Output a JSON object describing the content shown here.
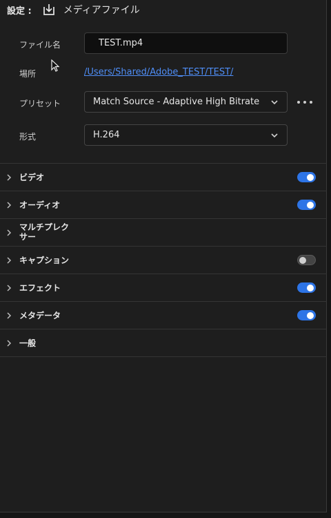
{
  "header": {
    "settings_label": "設定 :",
    "media_label": "メディアファイル",
    "export_icon": "download-icon"
  },
  "form": {
    "filename_label": "ファイル名",
    "filename_value": "TEST.mp4",
    "location_label": "場所",
    "location_value": "/Users/Shared/Adobe_TEST/TEST/",
    "preset_label": "プリセット",
    "preset_value": "Match Source - Adaptive High Bitrate",
    "format_label": "形式",
    "format_value": "H.264"
  },
  "sections": [
    {
      "title": "ビデオ",
      "toggle": "on"
    },
    {
      "title": "オーディオ",
      "toggle": "on"
    },
    {
      "title": "マルチプレクサー",
      "toggle": "none"
    },
    {
      "title": "キャプション",
      "toggle": "off"
    },
    {
      "title": "エフェクト",
      "toggle": "on"
    },
    {
      "title": "メタデータ",
      "toggle": "on"
    },
    {
      "title": "一般",
      "toggle": "none"
    }
  ],
  "colors": {
    "accent": "#2d74e6",
    "link": "#4f8ef7",
    "background": "#1e1e1e"
  }
}
